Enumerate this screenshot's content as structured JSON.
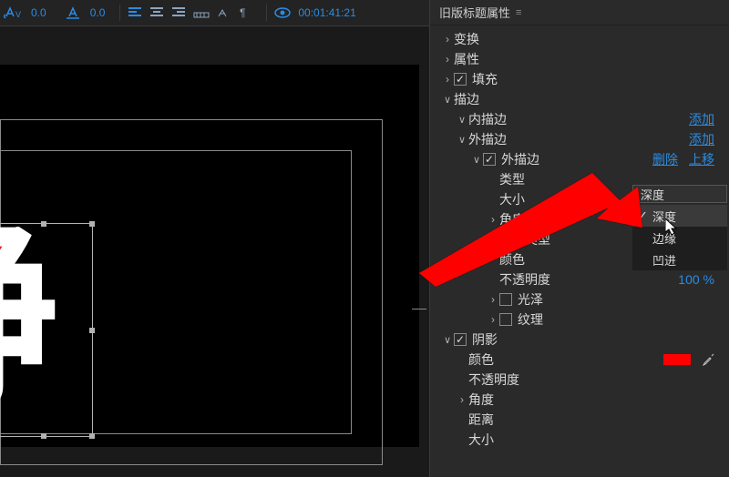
{
  "toolbar": {
    "va": "0.0",
    "ta": "0.0",
    "timecode": "00:01:41:21"
  },
  "glyph": "静",
  "panel": {
    "title": "旧版标题属性",
    "transform": "变换",
    "attributes": "属性",
    "fill": "填充",
    "stroke": "描边",
    "innerStroke": "内描边",
    "outerStroke": "外描边",
    "outerStrokeItem": "外描边",
    "type": "类型",
    "size": "大小",
    "angle": "角度",
    "fillType": "填充类型",
    "color": "颜色",
    "opacity": "不透明度",
    "opacityVal": "100 %",
    "gloss": "光泽",
    "texture": "纹理",
    "shadow": "阴影",
    "shadowColor": "颜色",
    "shadowOpacity": "不透明度",
    "shadowAngle": "角度",
    "distance": "距离",
    "shadowSize": "大小"
  },
  "actions": {
    "add": "添加",
    "delete": "删除",
    "moveUp": "上移"
  },
  "dropdown": {
    "current": "深度",
    "o1": "深度",
    "o2": "边缘",
    "o3": "凹进"
  }
}
